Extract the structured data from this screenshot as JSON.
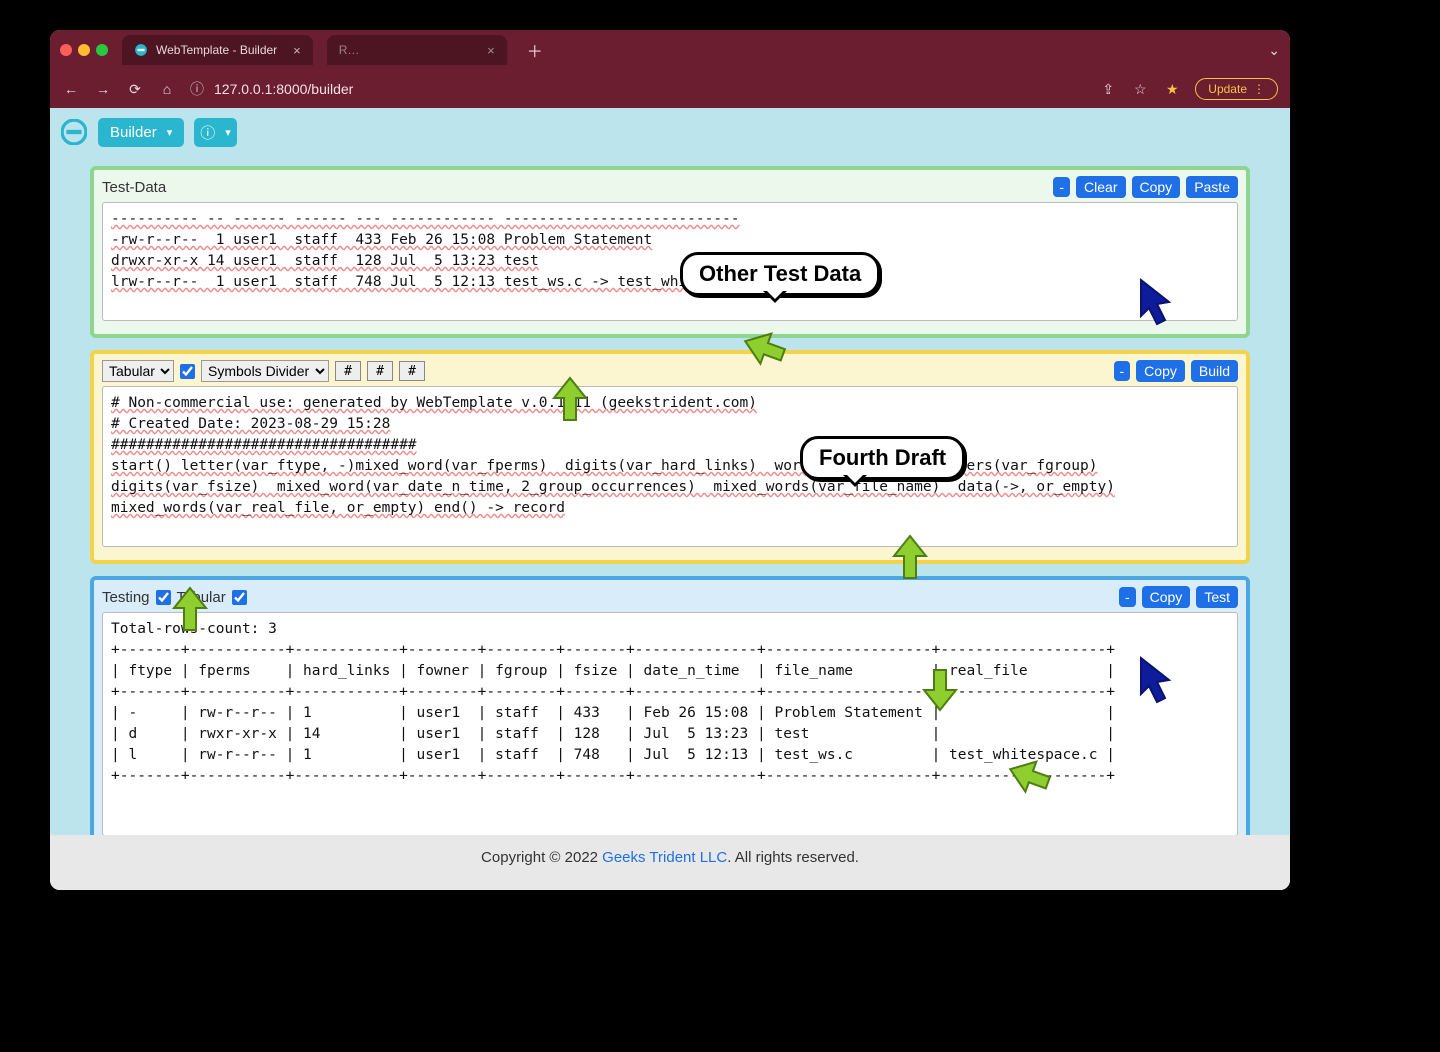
{
  "browser": {
    "tab_title": "WebTemplate - Builder",
    "url": "127.0.0.1:8000/builder",
    "update_label": "Update"
  },
  "toolbar": {
    "builder_label": "Builder"
  },
  "panel_testdata": {
    "title": "Test-Data",
    "buttons": {
      "min": "-",
      "clear": "Clear",
      "copy": "Copy",
      "paste": "Paste"
    },
    "content": "---------- -- ------ ------ --- ------------ ---------------------------\n-rw-r--r--  1 user1  staff  433 Feb 26 15:08 Problem Statement\ndrwxr-xr-x 14 user1  staff  128 Jul  5 13:23 test\nlrw-r--r--  1 user1  staff  748 Jul  5 12:13 test_ws.c -> test_whitespace.c"
  },
  "panel_template": {
    "select_mode": "Tabular",
    "select_divider": "Symbols Divider",
    "hash": "#",
    "buttons": {
      "min": "-",
      "copy": "Copy",
      "build": "Build"
    },
    "content": "# Non-commercial use: generated by WebTemplate v.0.1.11 (geekstrident.com)\n# Created Date: 2023-08-29 15:28\n###################################\nstart() letter(var_ftype, -)mixed_word(var_fperms)  digits(var_hard_links)  word(var_fowner)  letters(var_fgroup)\ndigits(var_fsize)  mixed_word(var_date_n_time, 2_group_occurrences)  mixed_words(var_file_name)  data(->, or_empty)\nmixed_words(var_real_file, or_empty) end() -> record"
  },
  "panel_testing": {
    "title": "Testing",
    "tabular_label": "Tabular",
    "buttons": {
      "min": "-",
      "copy": "Copy",
      "test": "Test"
    },
    "content": "Total-rows-count: 3\n+-------+-----------+------------+--------+--------+-------+--------------+-------------------+-------------------+\n| ftype | fperms    | hard_links | fowner | fgroup | fsize | date_n_time  | file_name         | real_file         |\n+-------+-----------+------------+--------+--------+-------+--------------+-------------------+-------------------+\n| -     | rw-r--r-- | 1          | user1  | staff  | 433   | Feb 26 15:08 | Problem Statement |                   |\n| d     | rwxr-xr-x | 14         | user1  | staff  | 128   | Jul  5 13:23 | test              |                   |\n| l     | rw-r--r-- | 1          | user1  | staff  | 748   | Jul  5 12:13 | test_ws.c         | test_whitespace.c |\n+-------+-----------+------------+--------+--------+-------+--------------+-------------------+-------------------+"
  },
  "footer": {
    "prefix": "Copyright © 2022 ",
    "link": "Geeks Trident LLC",
    "suffix": ". All rights reserved."
  },
  "callouts": {
    "b1": "Other Test Data",
    "b2": "Fourth Draft"
  }
}
